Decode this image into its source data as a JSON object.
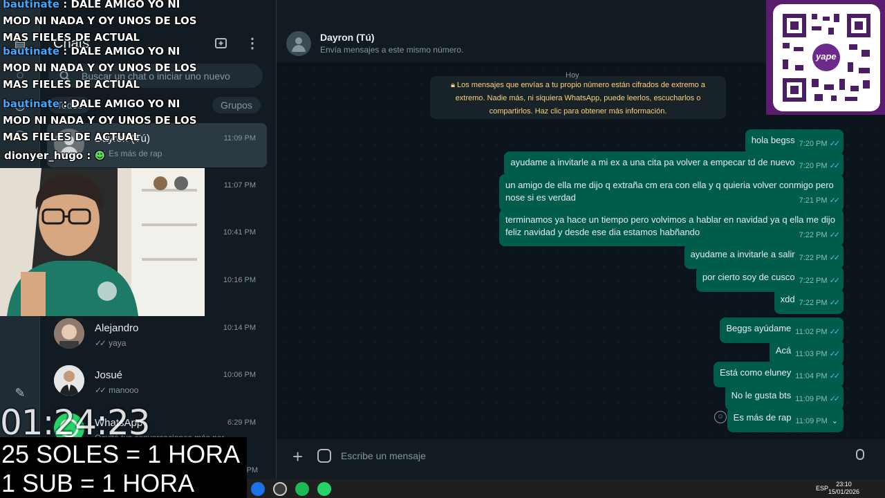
{
  "sidebar": {
    "title": "Chats",
    "search_placeholder": "Buscar un chat o iniciar uno nuevo",
    "filters": [
      "Todos",
      "Grupos"
    ],
    "chats": [
      {
        "name": "Dayron (Tú)",
        "time": "11:09 PM",
        "last": "Es más de rap",
        "active": true
      },
      {
        "name": "",
        "time": "11:07 PM",
        "last": ""
      },
      {
        "name": "",
        "time": "10:41 PM",
        "last": ""
      },
      {
        "name": "",
        "time": "10:16 PM",
        "last": ""
      },
      {
        "name": "Alejandro",
        "time": "10:14 PM",
        "last": "yaya"
      },
      {
        "name": "Josué",
        "time": "10:06 PM",
        "last": "manooo"
      },
      {
        "name": "WhatsApp",
        "time": "6:29 PM",
        "last": "Ocultá tus conversaciones más per..."
      }
    ],
    "partial_time": "PM"
  },
  "conversation": {
    "name": "Dayron (Tú)",
    "subtitle": "Envía mensajes a este mismo número.",
    "day_label": "Hoy",
    "encryption_note": "Los mensajes que envías a tu propio número están cifrados de extremo a extremo. Nadie más, ni siquiera WhatsApp, puede leerlos, escucharlos o compartirlos. Haz clic para obtener más información.",
    "messages": [
      {
        "text": "hola begss",
        "time": "7:20 PM"
      },
      {
        "text": "ayudame a invitarle a mi ex a una cita pa volver a empecar td de nuevo",
        "time": "7:20 PM"
      },
      {
        "text": "un amigo de ella me dijo q extraña cm era con ella y q quieria volver conmigo pero nose si es verdad",
        "time": "7:21 PM"
      },
      {
        "text": "terminamos ya hace un tiempo pero volvimos a hablar en navidad  ya q ella me dijo feliz navidad y desde ese dia estamos habñando",
        "time": "7:22 PM"
      },
      {
        "text": "ayudame a invitarle a salir",
        "time": "7:22 PM"
      },
      {
        "text": "por cierto soy de cusco",
        "time": "7:22 PM"
      },
      {
        "text": "xdd",
        "time": "7:22 PM"
      },
      {
        "text": "Beggs ayúdame",
        "time": "11:02 PM"
      },
      {
        "text": "Acá",
        "time": "11:03 PM"
      },
      {
        "text": "Está como eluney",
        "time": "11:04 PM"
      },
      {
        "text": "No le gusta bts",
        "time": "11:09 PM"
      },
      {
        "text": "Es más de rap",
        "time": "11:09 PM"
      }
    ],
    "composer_placeholder": "Escribe un mensaje"
  },
  "taskbar": {
    "language": "ESP",
    "time": "23:10",
    "date": "15/01/2026"
  },
  "overlay": {
    "chat_lines": [
      {
        "user": "bautinate",
        "text": ": DALE AMIGO YO NI MOD NI NADA Y OY UNOS DE LOS MAS FIELES DE ACTUAL"
      },
      {
        "user": "bautinate",
        "text": ": DALE AMIGO YO NI MOD NI NADA Y OY UNOS DE LOS MAS FIELES DE ACTUAL"
      },
      {
        "user": "bautinate",
        "text": ": DALE AMIGO YO NI MOD NI NADA Y OY UNOS DE LOS MAS FIELES DE ACTUAL"
      }
    ],
    "last_user": "dionyer_hugo :",
    "timer": "01:24:23",
    "promo_line1": "25 SOLES = 1 HORA",
    "promo_line2": "1 SUB = 1 HORA",
    "qr_label": "yape"
  }
}
